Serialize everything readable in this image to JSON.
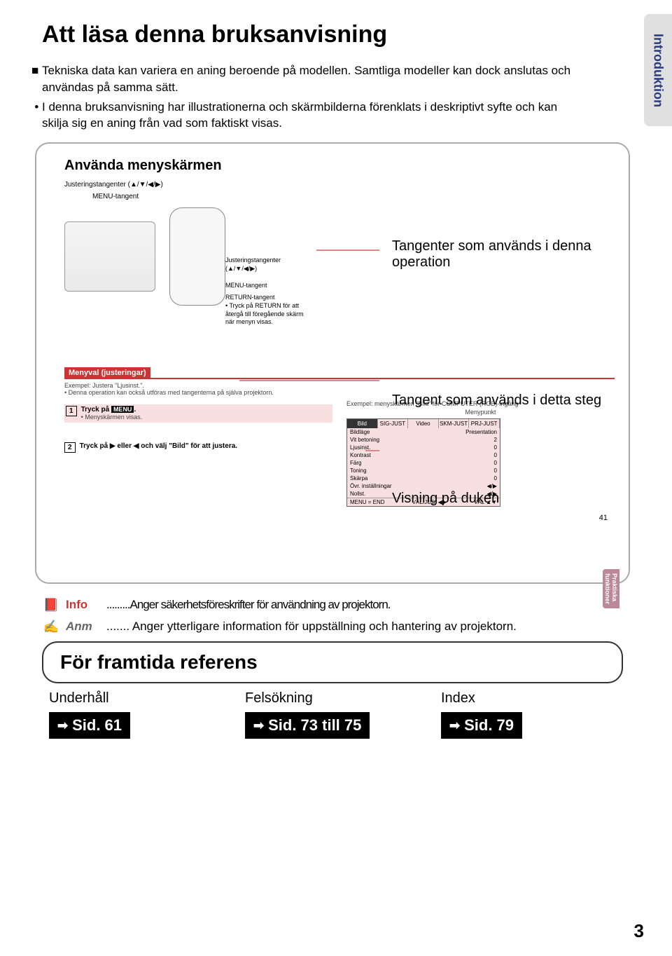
{
  "title": "Att läsa denna bruksanvisning",
  "side_tab": "Introduktion",
  "intro": {
    "bullet1": "Tekniska data kan variera en aning beroende på modellen. Samtliga modeller kan dock anslutas och användas på samma sätt.",
    "bullet2": "I denna bruksanvisning har illustrationerna och skärmbilderna förenklats i deskriptivt syfte och kan skilja sig en aning från vad som faktiskt visas."
  },
  "example": {
    "heading": "Använda menyskärmen",
    "adj_keys_label": "Justeringstangenter (▲/▼/◀/▶)",
    "menu_key_label": "MENU-tangent",
    "remote_labels": {
      "adj": "Justeringstangenter\n(▲/▼/◀/▶)",
      "menu": "MENU-tangent",
      "return_title": "RETURN-tangent",
      "return_note": "• Tryck på RETURN för att återgå till föregående skärm när menyn visas."
    },
    "menyval_title": "Menyval (justeringar)",
    "example_line": "Exempel: Justera \"Ljusinst.\".",
    "example_note": "• Denna operation kan också utföras med tangenterna på själva projektorn.",
    "step1_a": "Tryck på",
    "step1_btn": "MENU",
    "step1_b": ".",
    "step1_sub": "• Menyskärmen visas.",
    "step1_right": "Exempel: menyskärmen \"Bild\" för COMPUTER (RGB)-ingång",
    "menypunkt": "Menypunkt",
    "step2": "Tryck på ▶ eller ◀ och välj \"Bild\" för att justera.",
    "menu_tabs": [
      "Bild",
      "SIG-JUST",
      "Video",
      "SKM-JUST",
      "PRJ-JUST"
    ],
    "menu_rows": [
      {
        "k": "Bildläge",
        "v": "Presentation"
      },
      {
        "k": "Vit betoning",
        "v": "2"
      },
      {
        "k": "Ljusinst.",
        "v": "0"
      },
      {
        "k": "Kontrast",
        "v": "0"
      },
      {
        "k": "Färg",
        "v": "0"
      },
      {
        "k": "Toning",
        "v": "0"
      },
      {
        "k": "Skärpa",
        "v": "0"
      },
      {
        "k": "Övr. inställningar",
        "v": "◀/▶"
      },
      {
        "k": "Nollst.",
        "v": "◀/▶"
      }
    ],
    "menu_footer": [
      "MENU = END",
      "VÄL/JUS. ◀▶",
      "VÄL ▲▼"
    ],
    "prakt_tab": "Praktiska funktioner",
    "inner_page": "41"
  },
  "callouts": {
    "c1": "Tangenter som används i denna operation",
    "c2": "Tangent som används i detta steg",
    "c3": "Visning på duken"
  },
  "legend": {
    "info_label": "Info",
    "info_text": ".........Anger säkerhetsföreskrifter för användning av projektorn.",
    "anm_label": "Anm",
    "anm_text": "....... Anger ytterligare information för uppställning och hantering av projektorn."
  },
  "ref": {
    "title": "För framtida referens",
    "cols": [
      {
        "t": "Underhåll",
        "b": "Sid. 61"
      },
      {
        "t": "Felsökning",
        "b": "Sid. 73 till 75"
      },
      {
        "t": "Index",
        "b": "Sid. 79"
      }
    ]
  },
  "page_number": "3"
}
